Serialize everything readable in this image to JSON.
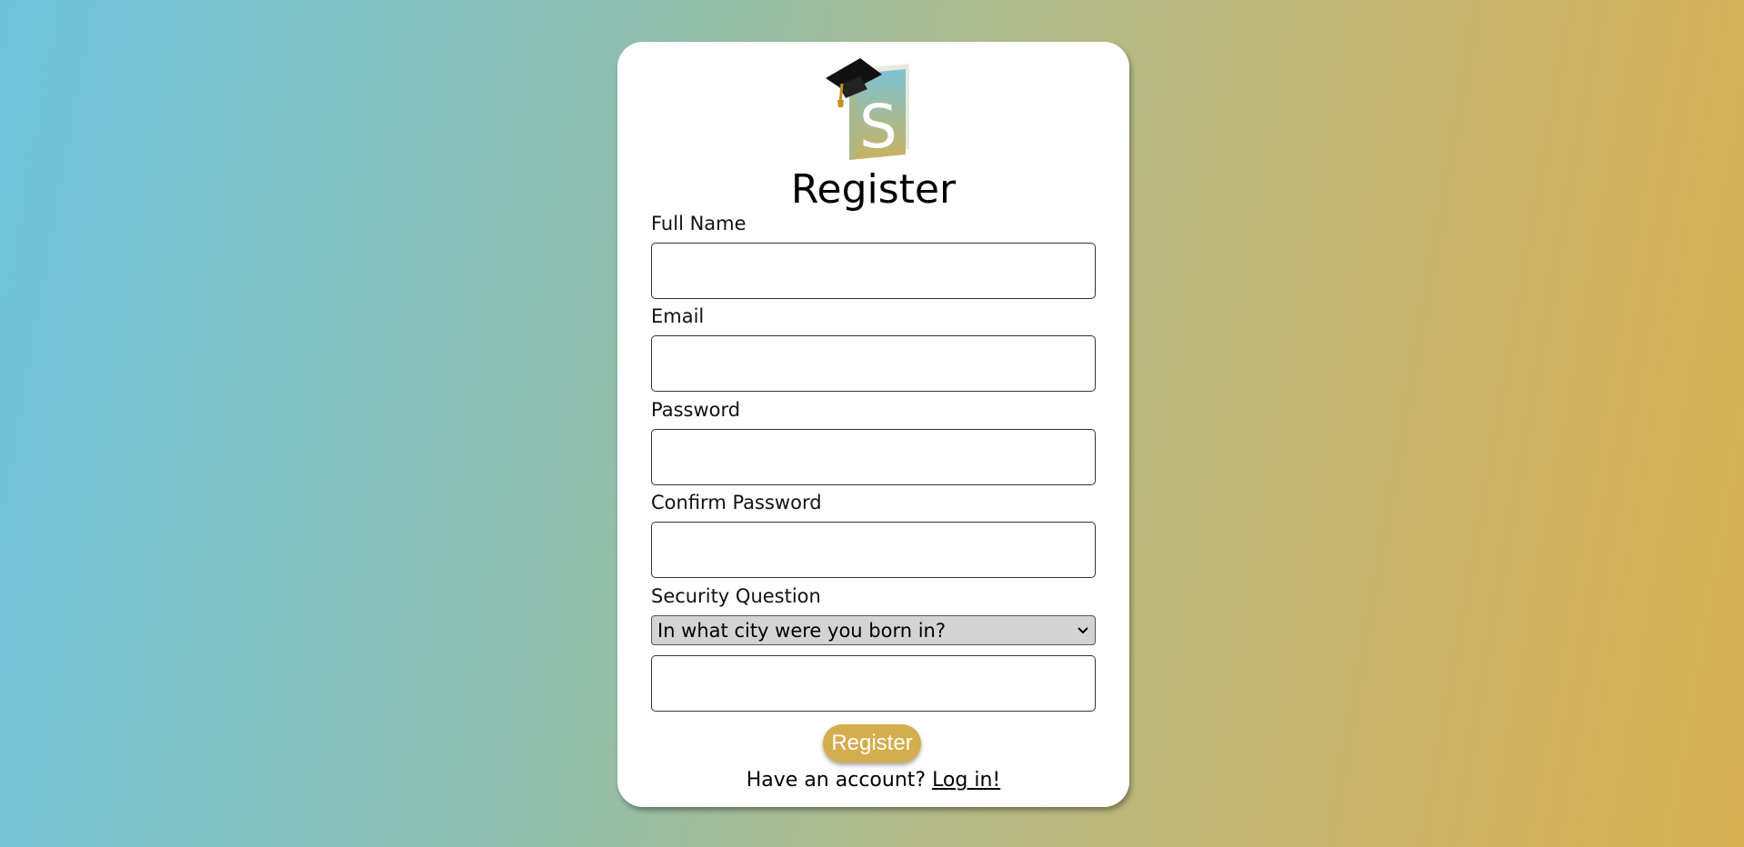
{
  "header": {
    "logo_icon": "graduation-book-logo",
    "logo_letter": "S",
    "title": "Register"
  },
  "form": {
    "full_name_label": "Full Name",
    "full_name_value": "",
    "email_label": "Email",
    "email_value": "",
    "password_label": "Password",
    "password_value": "",
    "confirm_password_label": "Confirm Password",
    "confirm_password_value": "",
    "security_question_label": "Security Question",
    "security_question_selected": "In what city were you born in?",
    "security_answer_value": "",
    "submit_label": "Register"
  },
  "footer": {
    "prompt": "Have an account?",
    "link_label": "Log in!"
  },
  "colors": {
    "accent": "#d4ad4c",
    "gradient_start": "#6ec3dc",
    "gradient_end": "#d8b052",
    "card_background": "#ffffff"
  }
}
